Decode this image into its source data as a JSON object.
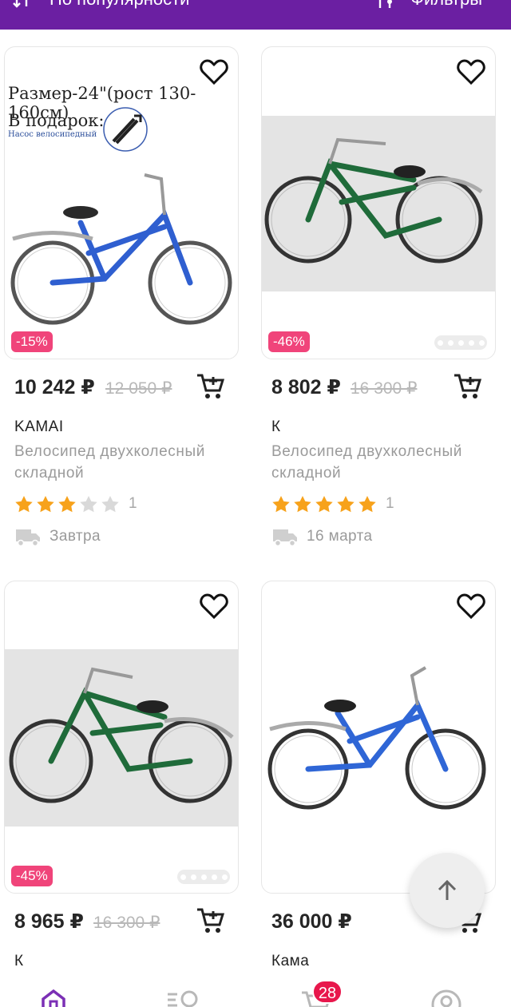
{
  "topbar": {
    "sort_label": "По популярности",
    "filter_label": "Фильтры",
    "background": "#6b1fa2",
    "sort_icon": "sort-arrows-icon",
    "filter_icon": "filter-icon"
  },
  "products": [
    {
      "image_caption_line1": "Размер-24\"(рост 130-160см)",
      "image_caption_line2": "В подарок:",
      "image_caption_line3": "Насос велосипедный",
      "discount": "-15%",
      "price": "10 242 ₽",
      "old_price": "12 050 ₽",
      "brand": "KAMAI",
      "title": "Велосипед двухколесный складной",
      "rating": 3,
      "reviews": "1",
      "delivery": "Завтра",
      "frame_color": "#2f5fd0",
      "has_dots": false
    },
    {
      "discount": "-46%",
      "price": "8 802 ₽",
      "old_price": "16 300 ₽",
      "brand": "К",
      "title": "Велосипед двухколесный складной",
      "rating": 5,
      "reviews": "1",
      "delivery": "16 марта",
      "frame_color": "#1f6b3a",
      "has_dots": true
    },
    {
      "discount": "-45%",
      "price": "8 965 ₽",
      "old_price": "16 300 ₽",
      "brand": "К",
      "frame_color": "#1f6b3a",
      "has_dots": true
    },
    {
      "price": "36 000 ₽",
      "brand": "Кама",
      "frame_color": "#2f66d6",
      "has_dots": false
    }
  ],
  "bottom_nav": {
    "items": [
      "home-icon",
      "catalog-search-icon",
      "cart-icon",
      "profile-icon"
    ],
    "cart_badge": "28",
    "active_color": "#7b2fb5"
  },
  "colors": {
    "accent": "#6b1fa2",
    "discount": "#f0447a",
    "star": "#f7a21b",
    "badge": "#e8174c"
  }
}
